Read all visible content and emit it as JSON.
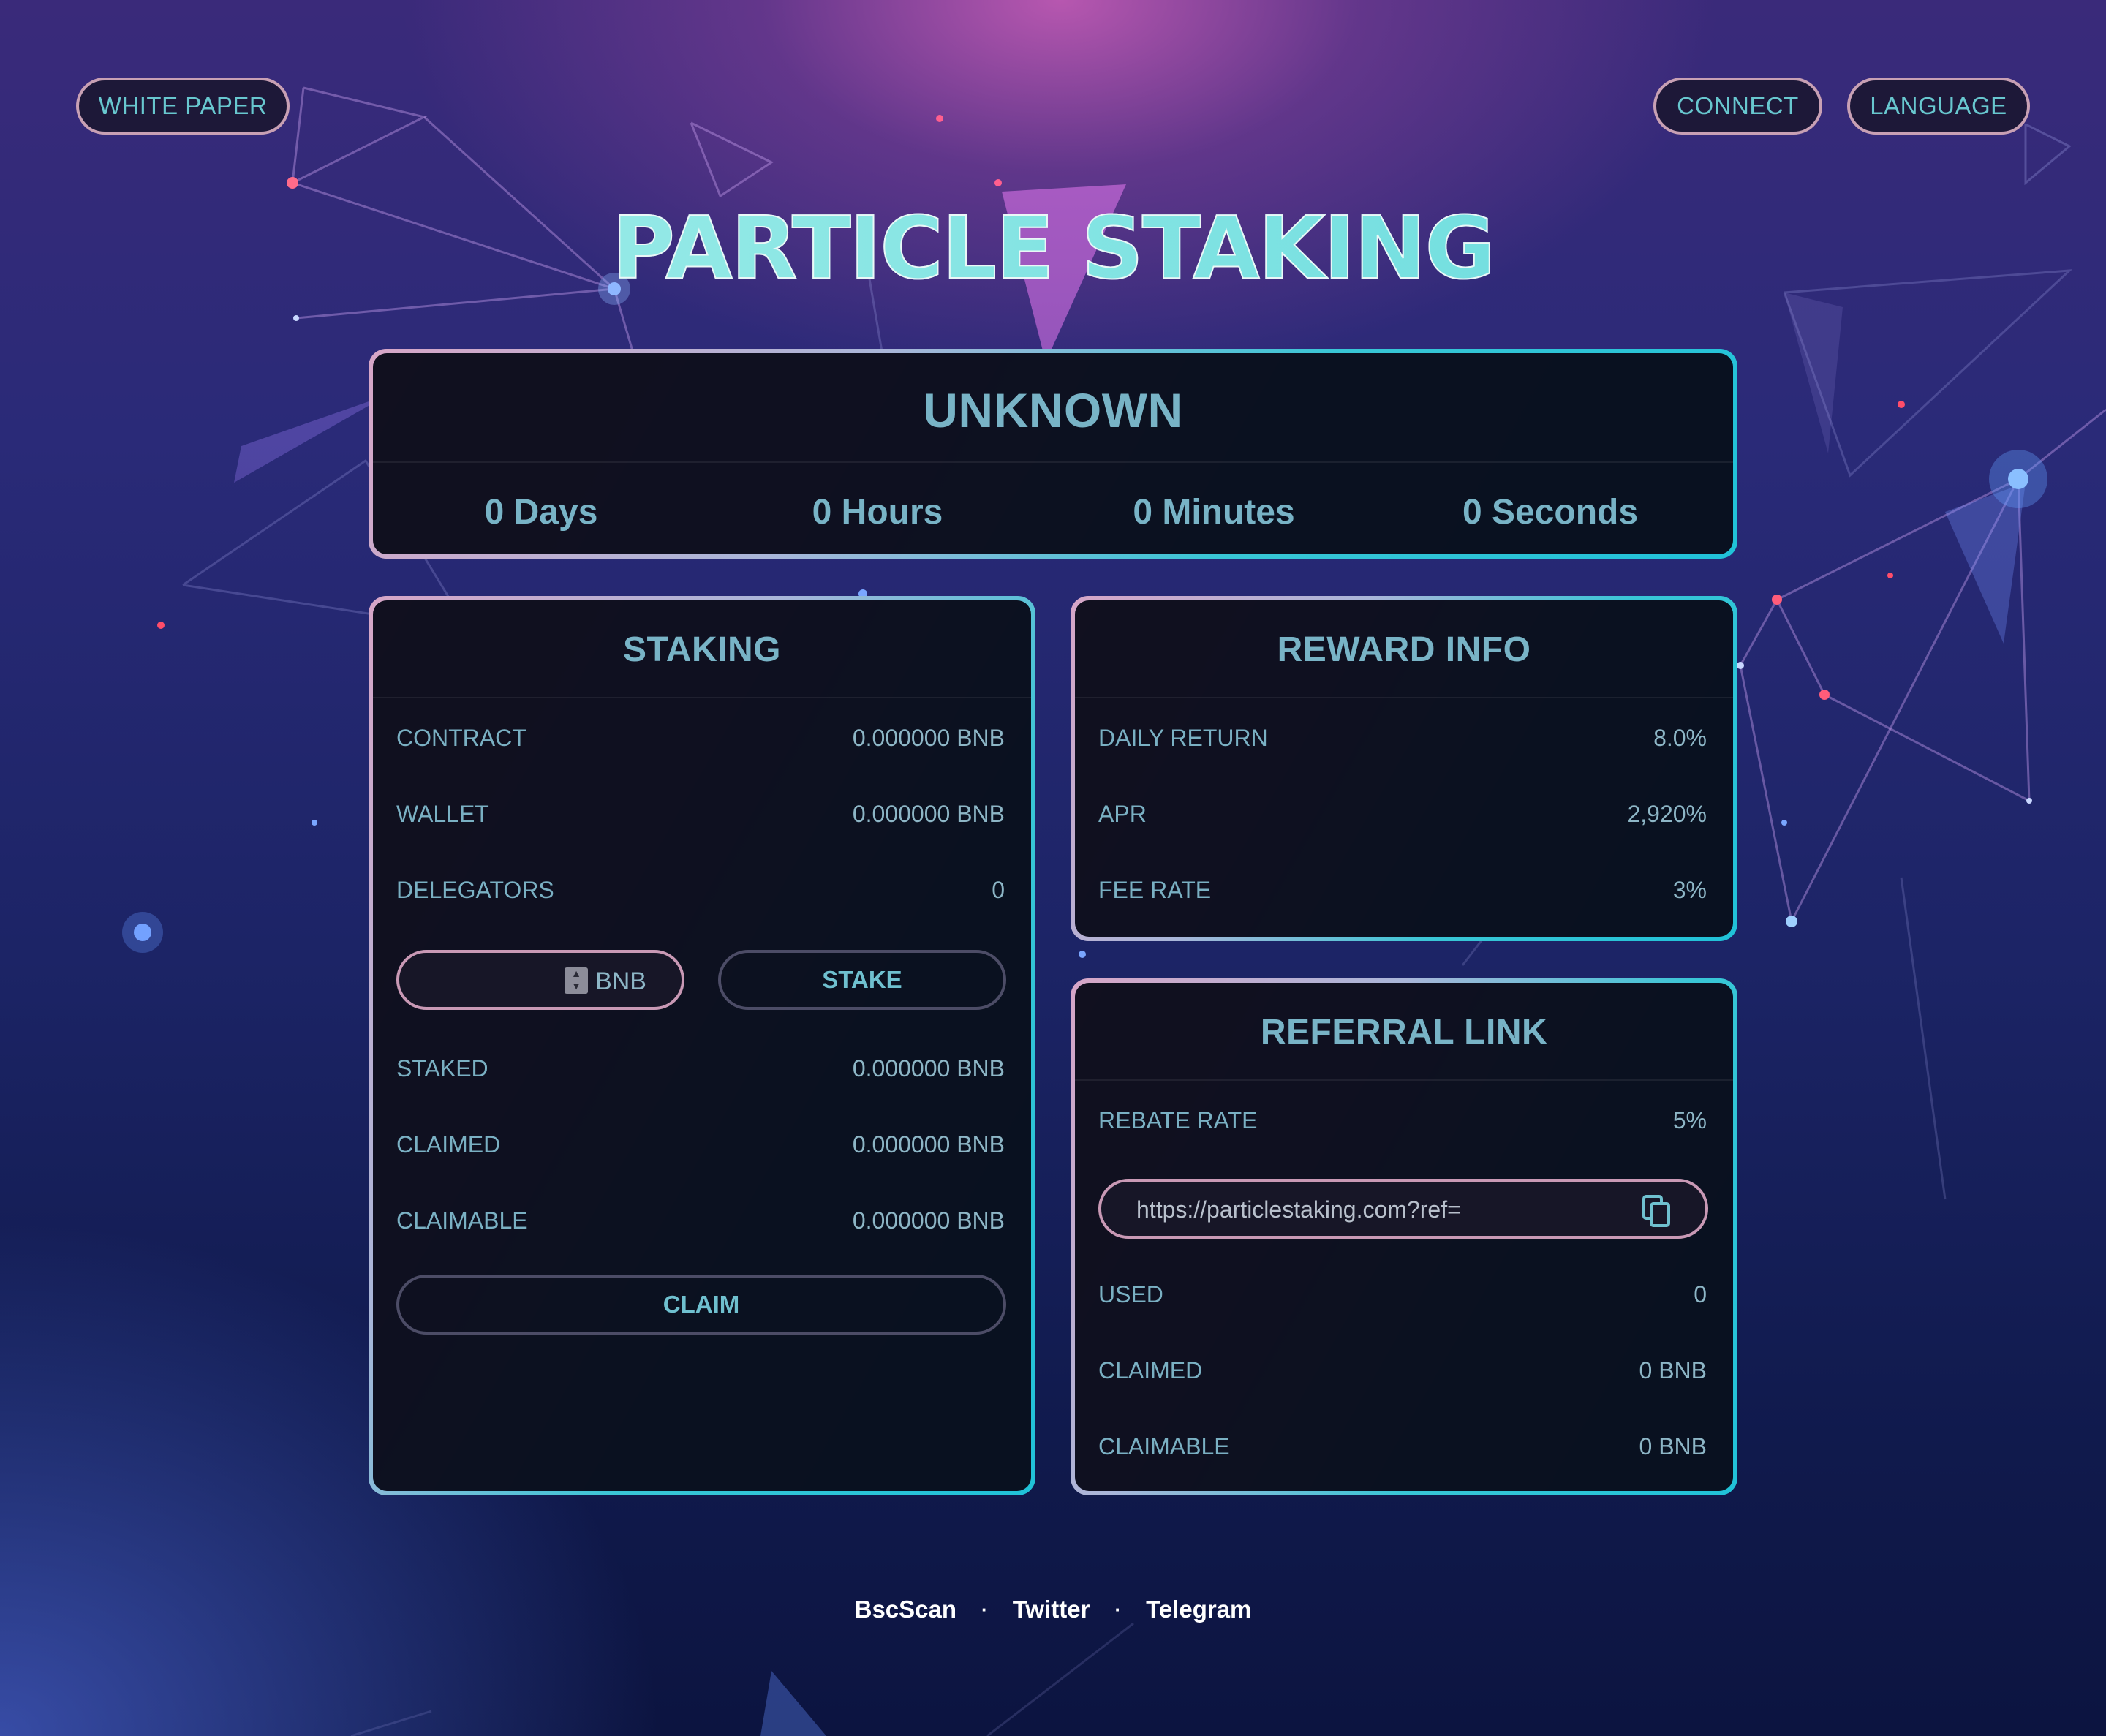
{
  "header": {
    "white_paper": "WHITE PAPER",
    "connect": "CONNECT",
    "language": "LANGUAGE"
  },
  "title": "PARTICLE STAKING",
  "countdown": {
    "status": "UNKNOWN",
    "days": "0 Days",
    "hours": "0 Hours",
    "minutes": "0 Minutes",
    "seconds": "0 Seconds"
  },
  "staking": {
    "title": "STAKING",
    "contract_label": "CONTRACT",
    "contract_value": "0.000000 BNB",
    "wallet_label": "WALLET",
    "wallet_value": "0.000000 BNB",
    "delegators_label": "DELEGATORS",
    "delegators_value": "0",
    "input_value": "",
    "input_unit": "BNB",
    "stake_button": "STAKE",
    "staked_label": "STAKED",
    "staked_value": "0.000000 BNB",
    "claimed_label": "CLAIMED",
    "claimed_value": "0.000000 BNB",
    "claimable_label": "CLAIMABLE",
    "claimable_value": "0.000000 BNB",
    "claim_button": "CLAIM"
  },
  "reward": {
    "title": "REWARD INFO",
    "daily_label": "DAILY RETURN",
    "daily_value": "8.0%",
    "apr_label": "APR",
    "apr_value": "2,920%",
    "fee_label": "FEE RATE",
    "fee_value": "3%"
  },
  "referral": {
    "title": "REFERRAL LINK",
    "rebate_label": "REBATE RATE",
    "rebate_value": "5%",
    "link": "https://particlestaking.com?ref=",
    "used_label": "USED",
    "used_value": "0",
    "claimed_label": "CLAIMED",
    "claimed_value": "0 BNB",
    "claimable_label": "CLAIMABLE",
    "claimable_value": "0 BNB"
  },
  "footer": {
    "bscscan": "BscScan",
    "twitter": "Twitter",
    "telegram": "Telegram",
    "separator": "·"
  },
  "colors": {
    "accent": "#68c7cf",
    "card_border_start": "#d7a6c7",
    "card_border_end": "#20c2d8",
    "card_bg": "#08091a",
    "pill_border": "#c8a0b4"
  }
}
